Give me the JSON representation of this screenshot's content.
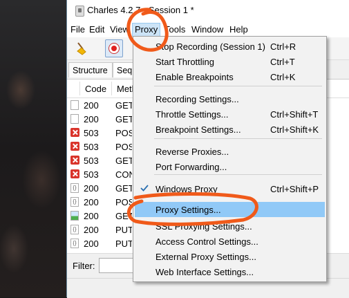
{
  "window": {
    "title": "Charles 4.2.7 - Session 1 *"
  },
  "menubar": {
    "items": [
      "File",
      "Edit",
      "View",
      "Proxy",
      "Tools",
      "Window",
      "Help"
    ]
  },
  "tabs": [
    "Structure",
    "Sequence"
  ],
  "table": {
    "headers": [
      "Code",
      "Method"
    ],
    "rows": [
      {
        "icon": "document-icon",
        "code": "200",
        "method": "GET"
      },
      {
        "icon": "document-icon",
        "code": "200",
        "method": "GET"
      },
      {
        "icon": "error-icon",
        "code": "503",
        "method": "POST"
      },
      {
        "icon": "error-icon",
        "code": "503",
        "method": "POST"
      },
      {
        "icon": "error-icon",
        "code": "503",
        "method": "GET"
      },
      {
        "icon": "error-icon",
        "code": "503",
        "method": "CONNECT"
      },
      {
        "icon": "json-icon",
        "code": "200",
        "method": "GET"
      },
      {
        "icon": "json-icon",
        "code": "200",
        "method": "POST"
      },
      {
        "icon": "image-icon",
        "code": "200",
        "method": "GET"
      },
      {
        "icon": "json-icon",
        "code": "200",
        "method": "PUT"
      },
      {
        "icon": "json-icon",
        "code": "200",
        "method": "PUT"
      }
    ]
  },
  "filter": {
    "label": "Filter:",
    "value": ""
  },
  "proxy_menu": {
    "items": [
      {
        "label": "Stop Recording (Session 1)",
        "shortcut": "Ctrl+R"
      },
      {
        "label": "Start Throttling",
        "shortcut": "Ctrl+T"
      },
      {
        "label": "Enable Breakpoints",
        "shortcut": "Ctrl+K"
      },
      {
        "label": "Recording Settings...",
        "shortcut": ""
      },
      {
        "label": "Throttle Settings...",
        "shortcut": "Ctrl+Shift+T"
      },
      {
        "label": "Breakpoint Settings...",
        "shortcut": "Ctrl+Shift+K"
      },
      {
        "label": "Reverse Proxies...",
        "shortcut": ""
      },
      {
        "label": "Port Forwarding...",
        "shortcut": ""
      },
      {
        "label": "Windows Proxy",
        "shortcut": "Ctrl+Shift+P",
        "checked": true
      },
      {
        "label": "Proxy Settings...",
        "shortcut": "",
        "highlighted": true
      },
      {
        "label": "SSL Proxying Settings...",
        "shortcut": ""
      },
      {
        "label": "Access Control Settings...",
        "shortcut": ""
      },
      {
        "label": "External Proxy Settings...",
        "shortcut": ""
      },
      {
        "label": "Web Interface Settings...",
        "shortcut": ""
      }
    ]
  },
  "colors": {
    "highlight": "#91c9f7",
    "annotation": "#f05a1a",
    "record": "#e02020",
    "error": "#d9342b"
  }
}
